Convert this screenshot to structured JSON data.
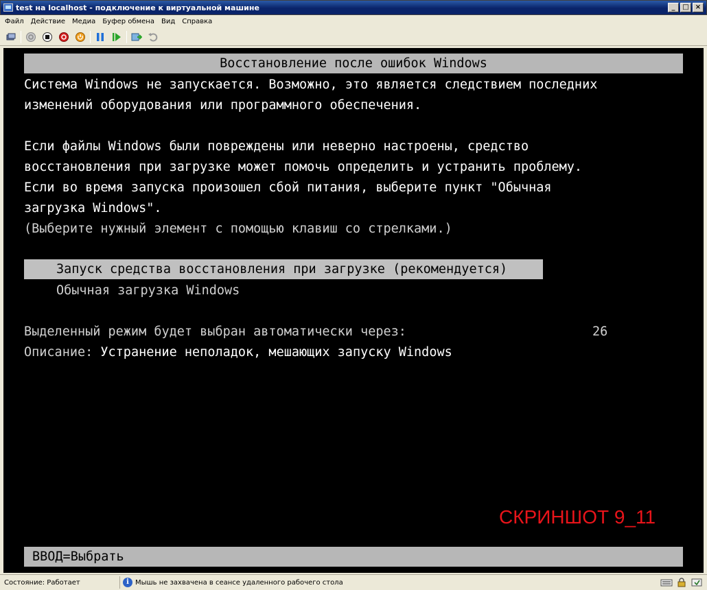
{
  "window": {
    "title": "test на localhost - подключение к виртуальной машине",
    "buttons": {
      "minimize": "_",
      "maximize": "□",
      "close": "×"
    }
  },
  "menu": [
    "Файл",
    "Действие",
    "Медиа",
    "Буфер обмена",
    "Вид",
    "Справка"
  ],
  "toolbar": {
    "icons": [
      "ctrl-alt-del-icon",
      "start-icon",
      "turn-off-icon",
      "shutdown-icon",
      "power-icon",
      "pause-icon",
      "resume-icon",
      "checkpoint-icon",
      "revert-icon"
    ]
  },
  "screen": {
    "header": "Восстановление после ошибок Windows",
    "paragraph1": [
      "Система Windows не запускается. Возможно, это является следствием последних",
      "изменений оборудования или программного обеспечения."
    ],
    "paragraph2": [
      "Если файлы Windows были повреждены или неверно настроены, средство",
      "восстановления при загрузке может помочь определить и устранить проблему.",
      "Если во время запуска произошел сбой питания, выберите пункт \"Обычная",
      "загрузка Windows\".",
      "(Выберите нужный элемент с помощью клавиш со стрелками.)"
    ],
    "options": [
      "Запуск средства восстановления при загрузке (рекомендуется)",
      "Обычная загрузка Windows"
    ],
    "countdown_label": "Выделенный режим будет выбран автоматически через:",
    "countdown_value": "26",
    "description_label": "Описание:",
    "description_text": "Устранение неполадок, мешающих запуску Windows",
    "watermark": "СКРИНШОТ 9_11",
    "footer": "ВВОД=Выбрать"
  },
  "status": {
    "state": "Состояние: Работает",
    "mouse": "Мышь не захвачена в сеансе удаленного рабочего стола"
  },
  "colors": {
    "title_bar": "#0a246a",
    "screen_bg": "#000000",
    "highlight_bar": "#b7b7b7",
    "watermark": "#e8141a"
  }
}
